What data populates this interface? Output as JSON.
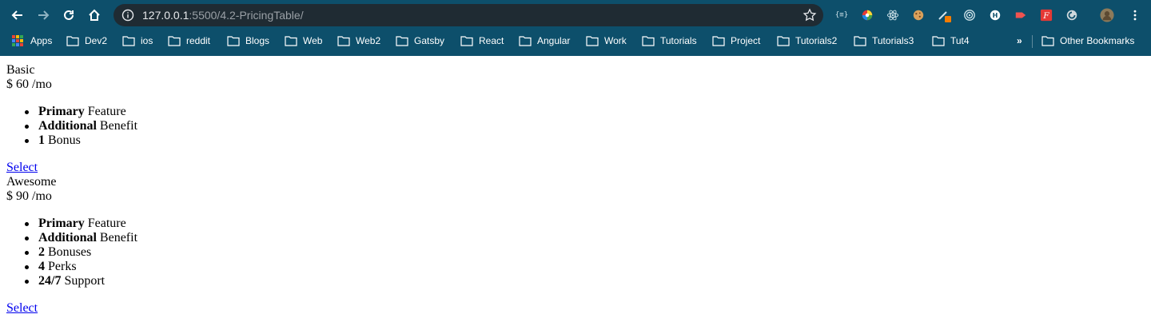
{
  "browser": {
    "url_host": "127.0.0.1",
    "url_rest": ":5500/4.2-PricingTable/",
    "extensions": [
      "{≡}",
      "color-wheel",
      "react",
      "cookie",
      "pen",
      "target",
      "H",
      "arrow",
      "F",
      "circle",
      "avatar"
    ],
    "bookmarks": {
      "apps_label": "Apps",
      "folders": [
        "Dev2",
        "ios",
        "reddit",
        "Blogs",
        "Web",
        "Web2",
        "Gatsby",
        "React",
        "Angular",
        "Work",
        "Tutorials",
        "Project",
        "Tutorials2",
        "Tutorials3",
        "Tut4"
      ],
      "overflow_label": "»",
      "other_label": "Other Bookmarks"
    },
    "colors": {
      "chrome_bg": "#0d4f6b",
      "omnibox_bg": "#1f2b33"
    }
  },
  "plans": [
    {
      "name": "Basic",
      "price": "$ 60 /mo",
      "features": [
        {
          "bold": "Primary",
          "text": " Feature"
        },
        {
          "bold": "Additional",
          "text": " Benefit"
        },
        {
          "bold": "1",
          "text": " Bonus"
        }
      ],
      "cta": "Select"
    },
    {
      "name": "Awesome",
      "price": "$ 90 /mo",
      "features": [
        {
          "bold": "Primary",
          "text": " Feature"
        },
        {
          "bold": "Additional",
          "text": " Benefit"
        },
        {
          "bold": "2",
          "text": " Bonuses"
        },
        {
          "bold": "4",
          "text": " Perks"
        },
        {
          "bold": "24/7",
          "text": " Support"
        }
      ],
      "cta": "Select"
    }
  ]
}
